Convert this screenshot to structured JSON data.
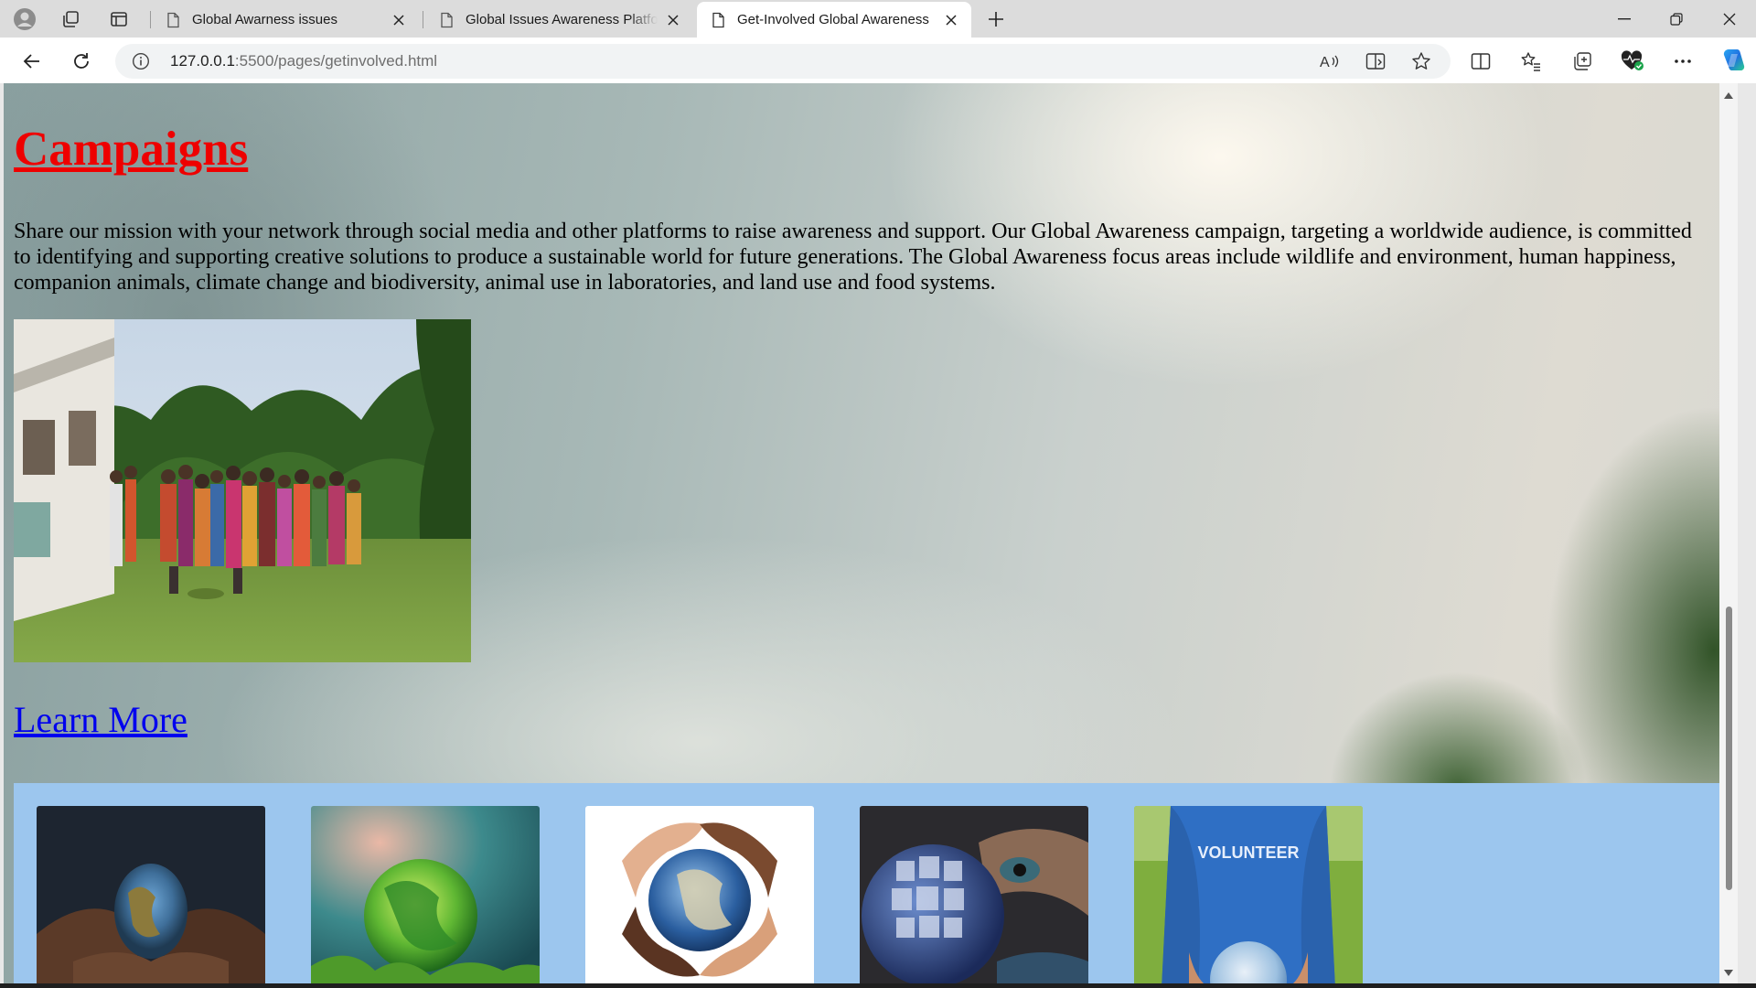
{
  "browser": {
    "tabs": [
      {
        "title": "Global Awarness issues",
        "active": false
      },
      {
        "title": "Global Issues Awareness Platform",
        "active": false
      },
      {
        "title": "Get-Involved Global Awareness",
        "active": true
      }
    ],
    "url_host": "127.0.0.1",
    "url_path": ":5500/pages/getinvolved.html",
    "icons": {
      "profile": "profile-icon",
      "workspaces": "workspaces-icon",
      "tab_actions": "vertical-tabs-icon",
      "new_tab": "plus-icon",
      "back": "back-arrow-icon",
      "reload": "reload-icon",
      "site_info": "info-icon",
      "read_aloud": "read-aloud-icon",
      "immersive_reader": "immersive-reader-icon",
      "favorite": "star-icon",
      "split_screen": "split-screen-icon",
      "favorites": "favorites-list-icon",
      "collections": "collections-icon",
      "browser_essentials": "heart-pulse-icon",
      "more": "ellipsis-icon",
      "copilot": "copilot-icon"
    }
  },
  "page": {
    "heading": "Campaigns",
    "paragraph": "Share our mission with your network through social media and other platforms to raise awareness and support. Our Global Awareness campaign, targeting a worldwide audience, is committed to identifying and supporting creative solutions to produce a sustainable world for future generations. The Global Awareness focus areas include wildlife and environment, human happiness, companion animals, climate change and biodiversity, animal use in laboratories, and land use and food systems.",
    "learn_more": "Learn More",
    "gallery_badge_text": "VOLUNTEER"
  },
  "colors": {
    "heading": "#ee0000",
    "link": "#0000ee",
    "gallery_bg": "#9cc6ee"
  }
}
